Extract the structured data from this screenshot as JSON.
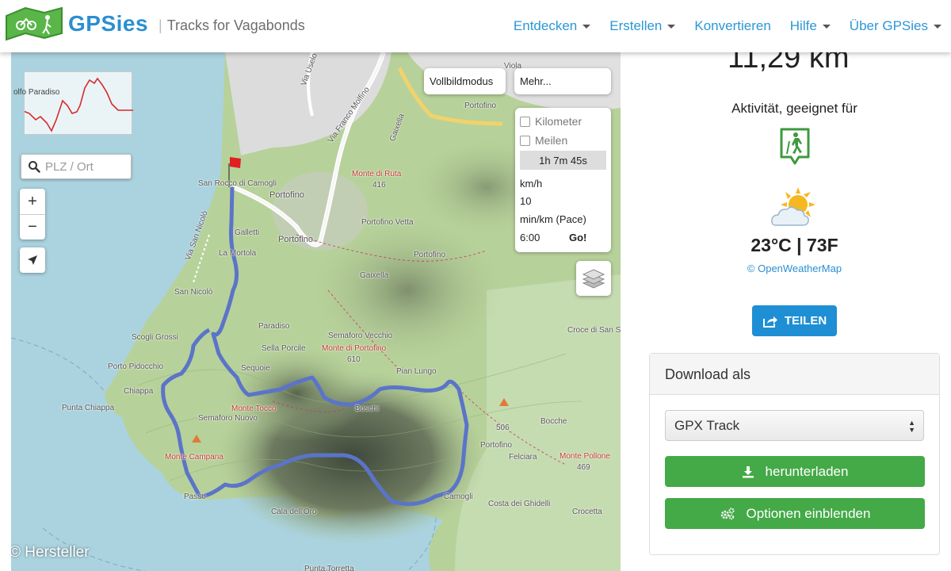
{
  "header": {
    "brand": "GPSies",
    "tagline": "Tracks for Vagabonds",
    "nav": [
      {
        "label": "Entdecken",
        "dropdown": true
      },
      {
        "label": "Erstellen",
        "dropdown": true
      },
      {
        "label": "Konvertieren",
        "dropdown": false
      },
      {
        "label": "Hilfe",
        "dropdown": true
      },
      {
        "label": "Über GPSies",
        "dropdown": true
      }
    ]
  },
  "map": {
    "elevation_label": "olfo Paradiso",
    "search_placeholder": "PLZ / Ort",
    "zoom_in": "+",
    "zoom_out": "−",
    "fullscreen_label": "Vollbildmodus",
    "more_label": "Mehr...",
    "calculator": {
      "kilometer": "Kilometer",
      "miles": "Meilen",
      "duration": "1h 7m 45s",
      "kmh_label": "km/h",
      "kmh_value": "10",
      "pace_label": "min/km (Pace)",
      "pace_value": "6:00",
      "go": "Go!"
    },
    "credit": "© Hersteller",
    "labels": [
      {
        "text": "San Rocco di Camogli"
      },
      {
        "text": "Portofino"
      },
      {
        "text": "Galletti"
      },
      {
        "text": "Portofino"
      },
      {
        "text": "La Mortola"
      },
      {
        "text": "Via San Nicolò"
      },
      {
        "text": "San Nicolò"
      },
      {
        "text": "Scogli Grossi"
      },
      {
        "text": "Paradiso"
      },
      {
        "text": "Sella Porcile"
      },
      {
        "text": "Sequoie"
      },
      {
        "text": "Porto Pidocchio"
      },
      {
        "text": "Chiappa"
      },
      {
        "text": "Punta Chiappa"
      },
      {
        "text": "Semaforo Vecchio"
      },
      {
        "text": "Monte di Portofino"
      },
      {
        "text": "610"
      },
      {
        "text": "Pian Lungo"
      },
      {
        "text": "Monte Tocco"
      },
      {
        "text": "Semaforo Nuovo"
      },
      {
        "text": "Monte Campana"
      },
      {
        "text": "Monte di Ruta"
      },
      {
        "text": "416"
      },
      {
        "text": "Portofino Vetta"
      },
      {
        "text": "Portofino"
      },
      {
        "text": "Gaixella"
      },
      {
        "text": "Croce di San Sé"
      },
      {
        "text": "Boschi"
      },
      {
        "text": "Bocche"
      },
      {
        "text": "506"
      },
      {
        "text": "Portofino"
      },
      {
        "text": "Felciara"
      },
      {
        "text": "Monte Pollone"
      },
      {
        "text": "469"
      },
      {
        "text": "Costa dei Ghidelli"
      },
      {
        "text": "Crocetta"
      },
      {
        "text": "Cala dell'Oro"
      },
      {
        "text": "Via Uselo"
      },
      {
        "text": "Via Franco Molfino"
      },
      {
        "text": "Gaixella"
      },
      {
        "text": "Viola"
      },
      {
        "text": "Portofino"
      },
      {
        "text": "Punta Torretta"
      },
      {
        "text": "Passo"
      },
      {
        "text": "Camogli"
      }
    ]
  },
  "stats": {
    "distance": "11,29 km",
    "activity_title": "Aktivität, geeignet für",
    "activity_icon": "hiking-icon",
    "temperature": "23°C | 73F",
    "weather_source": "© OpenWeatherMap"
  },
  "share_label": "TEILEN",
  "download": {
    "title": "Download als",
    "format": "GPX Track",
    "download_label": "herunterladen",
    "options_label": "Optionen einblenden"
  },
  "colors": {
    "brand_blue": "#2b8fd1",
    "green_button": "#44a947",
    "share_blue": "#1e8fd4",
    "track": "#5b74c9"
  }
}
